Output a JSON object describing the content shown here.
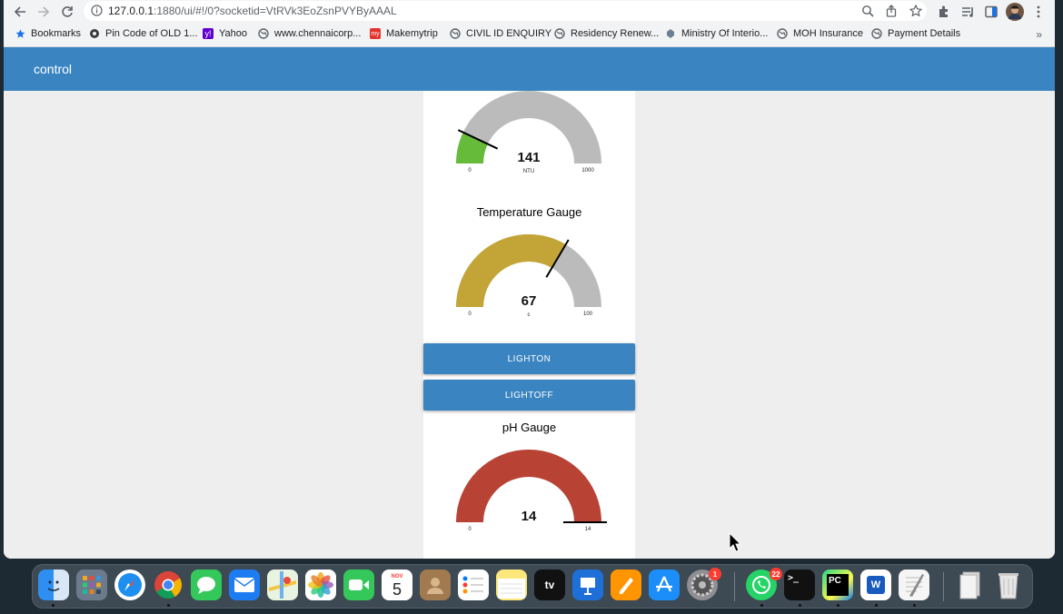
{
  "browser": {
    "url_host": "127.0.0.1",
    "url_rest": ":1880/ui/#!/0?socketid=VtRVk3EoZsnPVYByAAAL"
  },
  "bookmarks": {
    "items": [
      {
        "label": "Bookmarks",
        "icon": "star-icon"
      },
      {
        "label": "Pin Code of OLD 1...",
        "icon": "gear-flower-icon"
      },
      {
        "label": "Yahoo",
        "icon": "yahoo-icon"
      },
      {
        "label": "www.chennaicorp...",
        "icon": "globe-icon"
      },
      {
        "label": "Makemytrip",
        "icon": "makemytrip-icon"
      },
      {
        "label": "CIVIL ID ENQUIRY",
        "icon": "globe-icon"
      },
      {
        "label": "Residency Renew...",
        "icon": "globe-icon"
      },
      {
        "label": "Ministry Of Interio...",
        "icon": "emblem-icon"
      },
      {
        "label": "MOH Insurance",
        "icon": "globe-icon"
      },
      {
        "label": "Payment Details",
        "icon": "globe-icon"
      }
    ],
    "more": "»"
  },
  "dashboard": {
    "title": "control",
    "turbidity": {
      "title": "",
      "value": "141",
      "units": "NTU",
      "min": "0",
      "max": "1000",
      "level": 0.141,
      "color": "#66bb3a"
    },
    "temperature": {
      "title": "Temperature Gauge",
      "value": "67",
      "units": "c",
      "min": "0",
      "max": "100",
      "level": 0.67,
      "color": "#c3a537"
    },
    "buttons": {
      "light_on": "LIGHTON",
      "light_off": "LIGHTOFF"
    },
    "ph": {
      "title": "pH Gauge",
      "value": "14",
      "units": "",
      "min": "0",
      "max": "14",
      "level": 1.0,
      "color": "#b84335"
    }
  },
  "dock": {
    "calendar_month": "NOV",
    "calendar_day": "5",
    "tv_label": "tv",
    "whatsapp_badge": "22",
    "settings_badge": "1",
    "pycharm_label": "PC",
    "word_label": "W",
    "terminal_label": ">_"
  },
  "colors": {
    "accent": "#3a84c1",
    "gauge_track": "#bbbbbb"
  }
}
